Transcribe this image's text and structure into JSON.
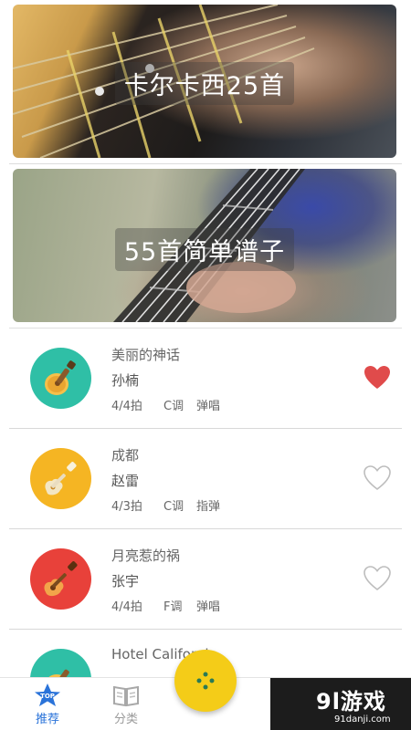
{
  "banners": [
    {
      "title": "卡尔卡西25首"
    },
    {
      "title": "55首简单谱子"
    }
  ],
  "songs": [
    {
      "title": "美丽的神话",
      "artist": "孙楠",
      "beat": "4/4拍",
      "key": "C调",
      "style": "弹唱",
      "favorited": true,
      "avatar_color": "#2fbfa6",
      "icon": "lute-icon"
    },
    {
      "title": "成都",
      "artist": "赵雷",
      "beat": "4/3拍",
      "key": "C调",
      "style": "指弹",
      "favorited": false,
      "avatar_color": "#f5b523",
      "icon": "electric-guitar-icon"
    },
    {
      "title": "月亮惹的祸",
      "artist": "张宇",
      "beat": "4/4拍",
      "key": "F调",
      "style": "弹唱",
      "favorited": false,
      "avatar_color": "#e8413a",
      "icon": "acoustic-guitar-icon"
    },
    {
      "title": "Hotel California",
      "artist": "",
      "beat": "",
      "key": "",
      "style": "",
      "favorited": false,
      "avatar_color": "#2fbfa6",
      "icon": "lute-icon"
    }
  ],
  "nav": {
    "top_badge": "TOP",
    "top_label": "推荐",
    "category_label": "分类"
  },
  "watermark": {
    "brand": "9l游戏",
    "url": "91danji.com"
  },
  "colors": {
    "heart_active": "#e04b4b",
    "heart_inactive": "#bdbdbd",
    "fab": "#f4cc18",
    "nav_active": "#2a73d9"
  }
}
